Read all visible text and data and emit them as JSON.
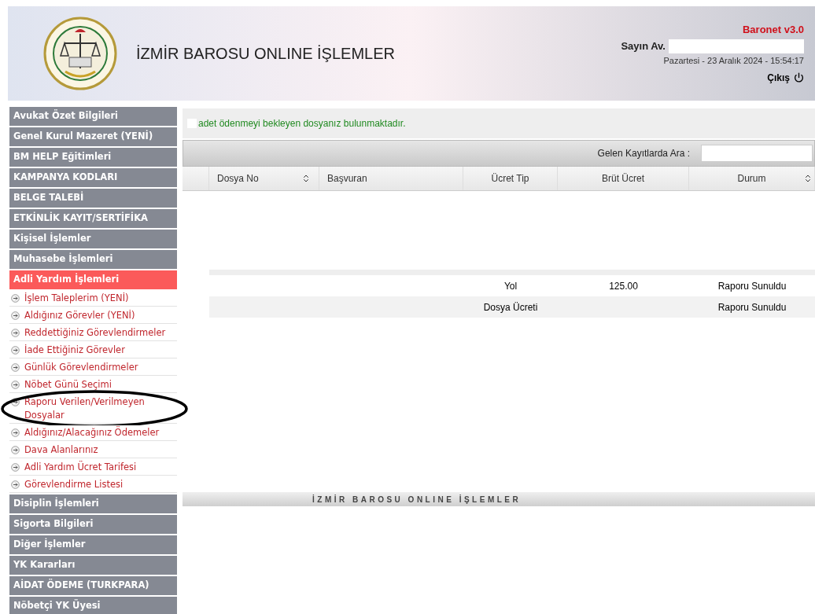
{
  "header": {
    "title": "İZMİR BAROSU ONLINE İŞLEMLER",
    "version": "Baronet v3.0",
    "greeting": "Sayın Av.",
    "name_redacted": true,
    "datetime": "Pazartesi - 23 Aralık 2024 - 15:54:17",
    "logout": "Çıkış"
  },
  "sidebar": {
    "items": [
      {
        "label": "Avukat Özet Bilgileri",
        "kind": "section",
        "selected": false
      },
      {
        "label": "Genel Kurul Mazeret (YENİ)",
        "kind": "section",
        "selected": false
      },
      {
        "label": "BM HELP Eğitimleri",
        "kind": "section",
        "selected": false
      },
      {
        "label": "KAMPANYA KODLARI",
        "kind": "section",
        "selected": false
      },
      {
        "label": "BELGE TALEBİ",
        "kind": "section",
        "selected": false
      },
      {
        "label": "ETKİNLİK KAYIT/SERTİFİKA",
        "kind": "section",
        "selected": false
      },
      {
        "label": "Kişisel İşlemler",
        "kind": "section",
        "selected": false
      },
      {
        "label": "Muhasebe İşlemleri",
        "kind": "section",
        "selected": false
      },
      {
        "label": "Adli Yardım İşlemleri",
        "kind": "section",
        "selected": true
      },
      {
        "label": "İşlem Taleplerim (YENİ)",
        "kind": "link",
        "circled": false
      },
      {
        "label": "Aldığınız Görevler (YENİ)",
        "kind": "link",
        "circled": false
      },
      {
        "label": "Reddettiğiniz Görevlendirmeler",
        "kind": "link",
        "circled": false
      },
      {
        "label": "İade Ettiğiniz Görevler",
        "kind": "link",
        "circled": false
      },
      {
        "label": "Günlük Görevlendirmeler",
        "kind": "link",
        "circled": false
      },
      {
        "label": "Nöbet Günü Seçimi",
        "kind": "link",
        "circled": false
      },
      {
        "label": "Raporu Verilen/Verilmeyen Dosyalar",
        "kind": "link",
        "circled": true
      },
      {
        "label": "Aldığınız/Alacağınız Ödemeler",
        "kind": "link",
        "circled": false
      },
      {
        "label": "Dava Alanlarınız",
        "kind": "link",
        "circled": false
      },
      {
        "label": "Adli Yardım Ücret Tarifesi",
        "kind": "link",
        "circled": false
      },
      {
        "label": "Görevlendirme Listesi",
        "kind": "link",
        "circled": false
      },
      {
        "label": "Disiplin İşlemleri",
        "kind": "section",
        "selected": false
      },
      {
        "label": "Sigorta Bilgileri",
        "kind": "section",
        "selected": false
      },
      {
        "label": "Diğer İşlemler",
        "kind": "section",
        "selected": false
      },
      {
        "label": "YK Kararları",
        "kind": "section",
        "selected": false
      },
      {
        "label": "AİDAT ÖDEME (TURKPARA)",
        "kind": "section",
        "selected": false
      },
      {
        "label": "Nöbetçi YK Üyesi",
        "kind": "section",
        "selected": false
      }
    ]
  },
  "notice": {
    "text": "adet ödenmeyi bekleyen dosyanız bulunmaktadır."
  },
  "search": {
    "label": "Gelen Kayıtlarda Ara :"
  },
  "table": {
    "columns": [
      {
        "label": "Dosya No",
        "sortable": true
      },
      {
        "label": "Başvuran",
        "sortable": false
      },
      {
        "label": "Ücret Tip",
        "sortable": false
      },
      {
        "label": "Brüt Ücret",
        "sortable": false
      },
      {
        "label": "Durum",
        "sortable": true
      }
    ],
    "rows": [
      {
        "cells": [
          {
            "kind": "blank"
          },
          {
            "kind": "blank"
          },
          {
            "kind": "text",
            "text": "Yol"
          },
          {
            "kind": "text",
            "text": "125.00"
          },
          {
            "kind": "text",
            "text": "Raporu Sunuldu"
          }
        ]
      },
      {
        "cells": [
          {
            "kind": "redacted"
          },
          {
            "kind": "redacted"
          },
          {
            "kind": "text",
            "text": "Dosya Ücreti"
          },
          {
            "kind": "redacted"
          },
          {
            "kind": "text",
            "text": "Raporu Sunuldu"
          }
        ]
      }
    ]
  },
  "footer": {
    "text": "İZMİR BAROSU ONLINE İŞLEMLER"
  }
}
